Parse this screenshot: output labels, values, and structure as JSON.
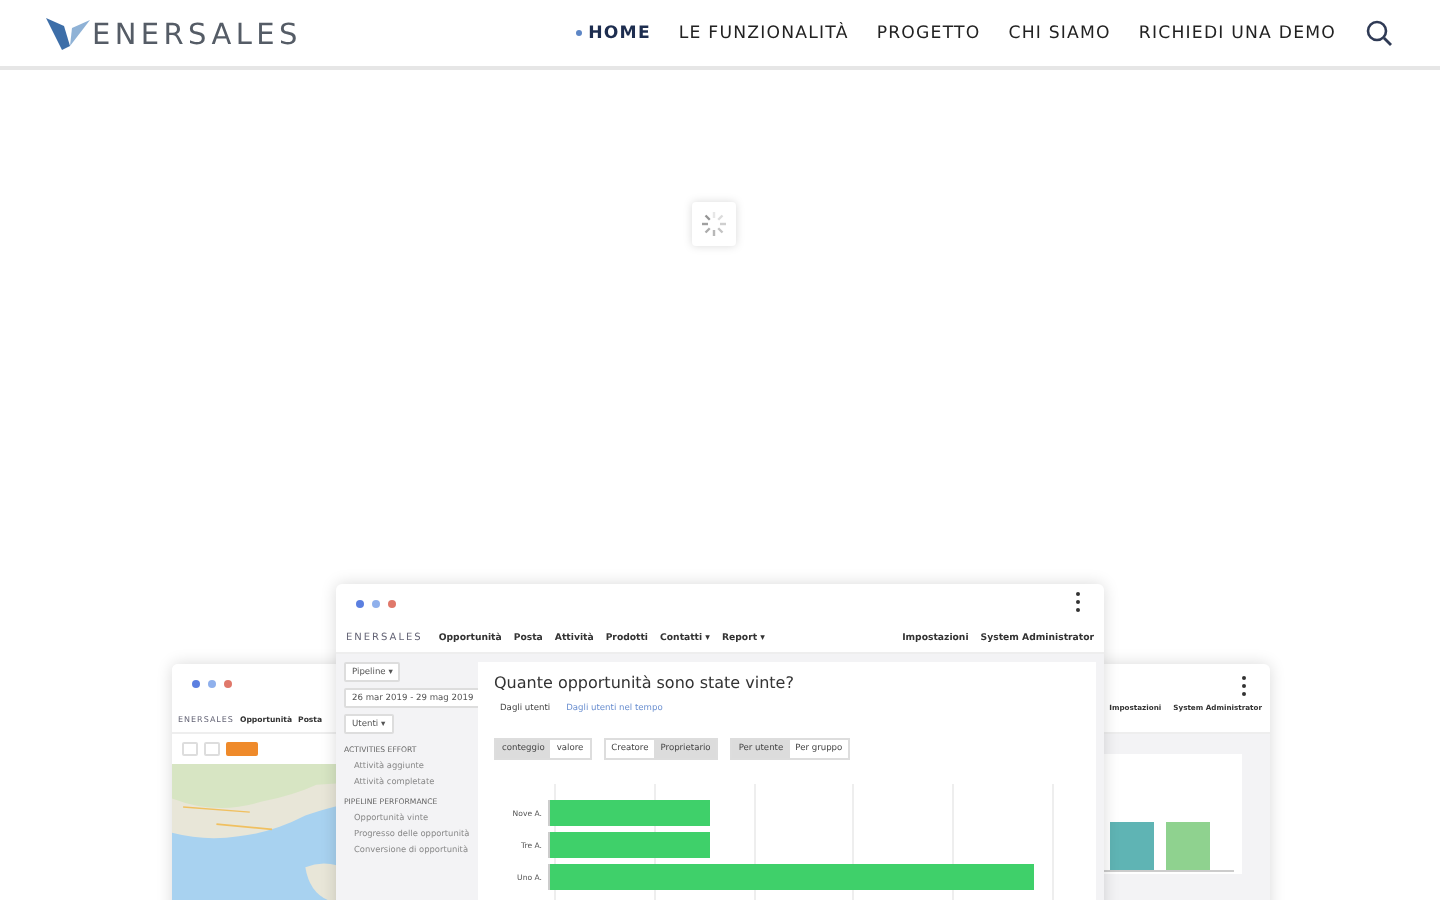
{
  "header": {
    "logo_text": "ENERSALES",
    "nav": [
      {
        "label": "HOME",
        "selected": true
      },
      {
        "label": "LE FUNZIONALITÀ",
        "selected": false
      },
      {
        "label": "PROGETTO",
        "selected": false
      },
      {
        "label": "CHI SIAMO",
        "selected": false
      },
      {
        "label": "RICHIEDI UNA DEMO",
        "selected": false
      }
    ]
  },
  "showcase": {
    "main_window": {
      "logo_text": "ENERSALES",
      "nav_left": [
        {
          "label": "Opportunità"
        },
        {
          "label": "Posta"
        },
        {
          "label": "Attività"
        },
        {
          "label": "Prodotti"
        },
        {
          "label": "Contatti",
          "caret": "▾"
        },
        {
          "label": "Report",
          "caret": "▾"
        }
      ],
      "nav_right": [
        "Impostazioni",
        "System Administrator"
      ],
      "filters": [
        {
          "label": "Pipeline",
          "caret": "▾"
        },
        {
          "label": "26 mar 2019 - 29 mag 2019"
        },
        {
          "label": "Utenti",
          "caret": "▾"
        }
      ],
      "sections": [
        {
          "title": "ACTIVITIES EFFORT",
          "items": [
            "Attività aggiunte",
            "Attività completate"
          ]
        },
        {
          "title": "PIPELINE PERFORMANCE",
          "items": [
            "Opportunità vinte",
            "Progresso delle opportunità",
            "Conversione di opportunità"
          ]
        }
      ],
      "question": "Quante opportunità sono state vinte?",
      "tabs": [
        {
          "label": "Dagli utenti",
          "selected": true
        },
        {
          "label": "Dagli utenti nel tempo",
          "selected": false
        }
      ],
      "toggles": [
        [
          {
            "label": "conteggio",
            "selected": true
          },
          {
            "label": "valore",
            "selected": false
          }
        ],
        [
          {
            "label": "Creatore",
            "selected": false
          },
          {
            "label": "Proprietario",
            "selected": true
          }
        ],
        [
          {
            "label": "Per utente",
            "selected": true
          },
          {
            "label": "Per gruppo",
            "selected": false
          }
        ]
      ],
      "bars": [
        {
          "label": "Nove A.",
          "level": 0.33
        },
        {
          "label": "Tre A.",
          "level": 0.33
        },
        {
          "label": "Uno A.",
          "level": 1
        }
      ]
    },
    "left_window": {
      "logo_text": "ENERSALES",
      "nav": [
        "Opportunità",
        "Posta"
      ]
    },
    "right_window": {
      "nav": [
        "Impostazioni",
        "System Administrator"
      ]
    }
  }
}
